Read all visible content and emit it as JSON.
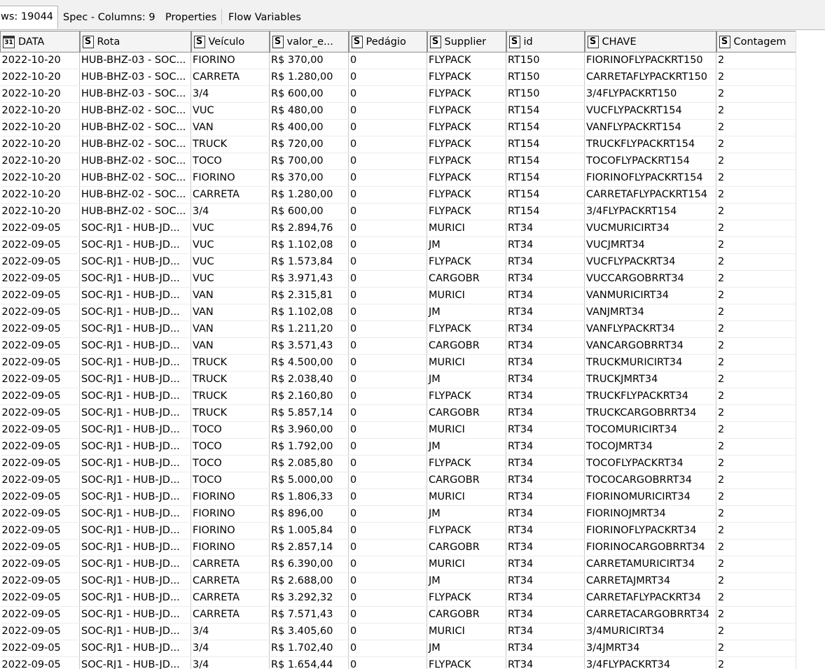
{
  "tabs": [
    {
      "label": "ws: 19044",
      "active": true
    },
    {
      "label": "Spec - Columns: 9",
      "active": false
    },
    {
      "label": "Properties",
      "active": false
    },
    {
      "label": "Flow Variables",
      "active": false
    }
  ],
  "columns": [
    {
      "type": "date",
      "label": "DATA"
    },
    {
      "type": "S",
      "label": "Rota"
    },
    {
      "type": "S",
      "label": "Veículo"
    },
    {
      "type": "S",
      "label": "valor_e..."
    },
    {
      "type": "S",
      "label": "Pedágio"
    },
    {
      "type": "S",
      "label": "Supplier"
    },
    {
      "type": "S",
      "label": "id"
    },
    {
      "type": "S",
      "label": "CHAVE"
    },
    {
      "type": "S",
      "label": "Contagem"
    }
  ],
  "icons": {
    "date": "calendar-icon",
    "string": "string-type-icon",
    "calendar_day": "31"
  },
  "rows": [
    [
      "2022-10-20",
      "HUB-BHZ-03 - SOC...",
      "FIORINO",
      "R$ 370,00",
      "0",
      "FLYPACK",
      "RT150",
      "FIORINOFLYPACKRT150",
      "2"
    ],
    [
      "2022-10-20",
      "HUB-BHZ-03 - SOC...",
      "CARRETA",
      "R$ 1.280,00",
      "0",
      "FLYPACK",
      "RT150",
      "CARRETAFLYPACKRT150",
      "2"
    ],
    [
      "2022-10-20",
      "HUB-BHZ-03 - SOC...",
      "3/4",
      "R$ 600,00",
      "0",
      "FLYPACK",
      "RT150",
      "3/4FLYPACKRT150",
      "2"
    ],
    [
      "2022-10-20",
      "HUB-BHZ-02 - SOC...",
      "VUC",
      "R$ 480,00",
      "0",
      "FLYPACK",
      "RT154",
      "VUCFLYPACKRT154",
      "2"
    ],
    [
      "2022-10-20",
      "HUB-BHZ-02 - SOC...",
      "VAN",
      "R$ 400,00",
      "0",
      "FLYPACK",
      "RT154",
      "VANFLYPACKRT154",
      "2"
    ],
    [
      "2022-10-20",
      "HUB-BHZ-02 - SOC...",
      "TRUCK",
      "R$ 720,00",
      "0",
      "FLYPACK",
      "RT154",
      "TRUCKFLYPACKRT154",
      "2"
    ],
    [
      "2022-10-20",
      "HUB-BHZ-02 - SOC...",
      "TOCO",
      "R$ 700,00",
      "0",
      "FLYPACK",
      "RT154",
      "TOCOFLYPACKRT154",
      "2"
    ],
    [
      "2022-10-20",
      "HUB-BHZ-02 - SOC...",
      "FIORINO",
      "R$ 370,00",
      "0",
      "FLYPACK",
      "RT154",
      "FIORINOFLYPACKRT154",
      "2"
    ],
    [
      "2022-10-20",
      "HUB-BHZ-02 - SOC...",
      "CARRETA",
      "R$ 1.280,00",
      "0",
      "FLYPACK",
      "RT154",
      "CARRETAFLYPACKRT154",
      "2"
    ],
    [
      "2022-10-20",
      "HUB-BHZ-02 - SOC...",
      "3/4",
      "R$ 600,00",
      "0",
      "FLYPACK",
      "RT154",
      "3/4FLYPACKRT154",
      "2"
    ],
    [
      "2022-09-05",
      "SOC-RJ1 - HUB-JD...",
      "VUC",
      "R$ 2.894,76",
      "0",
      "MURICI",
      "RT34",
      "VUCMURICIRT34",
      "2"
    ],
    [
      "2022-09-05",
      "SOC-RJ1 - HUB-JD...",
      "VUC",
      "R$ 1.102,08",
      "0",
      "JM",
      "RT34",
      "VUCJMRT34",
      "2"
    ],
    [
      "2022-09-05",
      "SOC-RJ1 - HUB-JD...",
      "VUC",
      "R$ 1.573,84",
      "0",
      "FLYPACK",
      "RT34",
      "VUCFLYPACKRT34",
      "2"
    ],
    [
      "2022-09-05",
      "SOC-RJ1 - HUB-JD...",
      "VUC",
      "R$ 3.971,43",
      "0",
      "CARGOBR",
      "RT34",
      "VUCCARGOBRRT34",
      "2"
    ],
    [
      "2022-09-05",
      "SOC-RJ1 - HUB-JD...",
      "VAN",
      "R$ 2.315,81",
      "0",
      "MURICI",
      "RT34",
      "VANMURICIRT34",
      "2"
    ],
    [
      "2022-09-05",
      "SOC-RJ1 - HUB-JD...",
      "VAN",
      "R$ 1.102,08",
      "0",
      "JM",
      "RT34",
      "VANJMRT34",
      "2"
    ],
    [
      "2022-09-05",
      "SOC-RJ1 - HUB-JD...",
      "VAN",
      "R$ 1.211,20",
      "0",
      "FLYPACK",
      "RT34",
      "VANFLYPACKRT34",
      "2"
    ],
    [
      "2022-09-05",
      "SOC-RJ1 - HUB-JD...",
      "VAN",
      "R$ 3.571,43",
      "0",
      "CARGOBR",
      "RT34",
      "VANCARGOBRRT34",
      "2"
    ],
    [
      "2022-09-05",
      "SOC-RJ1 - HUB-JD...",
      "TRUCK",
      "R$ 4.500,00",
      "0",
      "MURICI",
      "RT34",
      "TRUCKMURICIRT34",
      "2"
    ],
    [
      "2022-09-05",
      "SOC-RJ1 - HUB-JD...",
      "TRUCK",
      "R$ 2.038,40",
      "0",
      "JM",
      "RT34",
      "TRUCKJMRT34",
      "2"
    ],
    [
      "2022-09-05",
      "SOC-RJ1 - HUB-JD...",
      "TRUCK",
      "R$ 2.160,80",
      "0",
      "FLYPACK",
      "RT34",
      "TRUCKFLYPACKRT34",
      "2"
    ],
    [
      "2022-09-05",
      "SOC-RJ1 - HUB-JD...",
      "TRUCK",
      "R$ 5.857,14",
      "0",
      "CARGOBR",
      "RT34",
      "TRUCKCARGOBRRT34",
      "2"
    ],
    [
      "2022-09-05",
      "SOC-RJ1 - HUB-JD...",
      "TOCO",
      "R$ 3.960,00",
      "0",
      "MURICI",
      "RT34",
      "TOCOMURICIRT34",
      "2"
    ],
    [
      "2022-09-05",
      "SOC-RJ1 - HUB-JD...",
      "TOCO",
      "R$ 1.792,00",
      "0",
      "JM",
      "RT34",
      "TOCOJMRT34",
      "2"
    ],
    [
      "2022-09-05",
      "SOC-RJ1 - HUB-JD...",
      "TOCO",
      "R$ 2.085,80",
      "0",
      "FLYPACK",
      "RT34",
      "TOCOFLYPACKRT34",
      "2"
    ],
    [
      "2022-09-05",
      "SOC-RJ1 - HUB-JD...",
      "TOCO",
      "R$ 5.000,00",
      "0",
      "CARGOBR",
      "RT34",
      "TOCOCARGOBRRT34",
      "2"
    ],
    [
      "2022-09-05",
      "SOC-RJ1 - HUB-JD...",
      "FIORINO",
      "R$ 1.806,33",
      "0",
      "MURICI",
      "RT34",
      "FIORINOMURICIRT34",
      "2"
    ],
    [
      "2022-09-05",
      "SOC-RJ1 - HUB-JD...",
      "FIORINO",
      "R$ 896,00",
      "0",
      "JM",
      "RT34",
      "FIORINOJMRT34",
      "2"
    ],
    [
      "2022-09-05",
      "SOC-RJ1 - HUB-JD...",
      "FIORINO",
      "R$ 1.005,84",
      "0",
      "FLYPACK",
      "RT34",
      "FIORINOFLYPACKRT34",
      "2"
    ],
    [
      "2022-09-05",
      "SOC-RJ1 - HUB-JD...",
      "FIORINO",
      "R$ 2.857,14",
      "0",
      "CARGOBR",
      "RT34",
      "FIORINOCARGOBRRT34",
      "2"
    ],
    [
      "2022-09-05",
      "SOC-RJ1 - HUB-JD...",
      "CARRETA",
      "R$ 6.390,00",
      "0",
      "MURICI",
      "RT34",
      "CARRETAMURICIRT34",
      "2"
    ],
    [
      "2022-09-05",
      "SOC-RJ1 - HUB-JD...",
      "CARRETA",
      "R$ 2.688,00",
      "0",
      "JM",
      "RT34",
      "CARRETAJMRT34",
      "2"
    ],
    [
      "2022-09-05",
      "SOC-RJ1 - HUB-JD...",
      "CARRETA",
      "R$ 3.292,32",
      "0",
      "FLYPACK",
      "RT34",
      "CARRETAFLYPACKRT34",
      "2"
    ],
    [
      "2022-09-05",
      "SOC-RJ1 - HUB-JD...",
      "CARRETA",
      "R$ 7.571,43",
      "0",
      "CARGOBR",
      "RT34",
      "CARRETACARGOBRRT34",
      "2"
    ],
    [
      "2022-09-05",
      "SOC-RJ1 - HUB-JD...",
      "3/4",
      "R$ 3.405,60",
      "0",
      "MURICI",
      "RT34",
      "3/4MURICIRT34",
      "2"
    ],
    [
      "2022-09-05",
      "SOC-RJ1 - HUB-JD...",
      "3/4",
      "R$ 1.702,40",
      "0",
      "JM",
      "RT34",
      "3/4JMRT34",
      "2"
    ],
    [
      "2022-09-05",
      "SOC-RJ1 - HUB-JD...",
      "3/4",
      "R$ 1.654,44",
      "0",
      "FLYPACK",
      "RT34",
      "3/4FLYPACKRT34",
      "2"
    ]
  ]
}
